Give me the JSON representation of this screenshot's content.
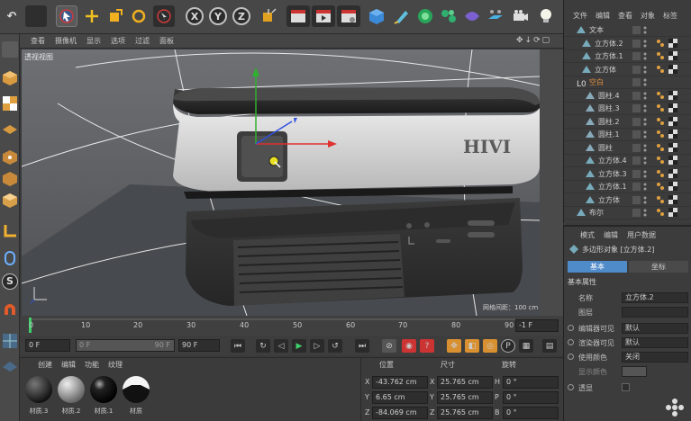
{
  "top_toolbar": {
    "undo": "↶",
    "x": "X",
    "y": "Y",
    "z": "Z"
  },
  "viewport_menu": [
    "查看",
    "摄像机",
    "显示",
    "选项",
    "过滤",
    "面板"
  ],
  "viewport": {
    "label": "透视视图",
    "brand_text": "HIVI",
    "grid_spacing": "网格间距：100 cm"
  },
  "timeline": {
    "ticks": [
      "0",
      "10",
      "20",
      "30",
      "40",
      "50",
      "60",
      "70",
      "80",
      "90"
    ],
    "frame_field": "-1 F"
  },
  "playbar": {
    "start": "0 F",
    "range_start": "0 F",
    "range_end": "90 F",
    "end": "90 F"
  },
  "materials": {
    "menu": [
      "创建",
      "编辑",
      "功能",
      "纹理"
    ],
    "items": [
      "材质.3",
      "材质.2",
      "材质.1",
      "材质"
    ]
  },
  "coordinates": {
    "headers": [
      "位置",
      "尺寸",
      "旋转"
    ],
    "rows": [
      {
        "axis": "X",
        "pos": "-43.762 cm",
        "size": "25.765 cm",
        "rot_axis": "H",
        "rot": "0 °"
      },
      {
        "axis": "Y",
        "pos": "6.65 cm",
        "size": "25.765 cm",
        "rot_axis": "P",
        "rot": "0 °"
      },
      {
        "axis": "Z",
        "pos": "-84.069 cm",
        "size": "25.765 cm",
        "rot_axis": "B",
        "rot": "0 °"
      }
    ]
  },
  "object_manager": {
    "menu": [
      "文件",
      "编辑",
      "查看",
      "对象",
      "标签"
    ],
    "objects": [
      "文本",
      "立方体.2",
      "立方体.1",
      "立方体",
      "空白",
      "圆柱.4",
      "圆柱.3",
      "圆柱.2",
      "圆柱.1",
      "圆柱",
      "立方体.4",
      "立方体.3",
      "立方体.1",
      "立方体",
      "布尔"
    ]
  },
  "attributes": {
    "menu": [
      "模式",
      "编辑",
      "用户数据"
    ],
    "title": "多边形对象 [立方体.2]",
    "tabs": [
      "基本",
      "坐标"
    ],
    "section": "基本属性",
    "fields": [
      {
        "label": "名称",
        "value": "立方体.2"
      },
      {
        "label": "图层",
        "value": ""
      },
      {
        "label": "编辑器可见",
        "value": "默认"
      },
      {
        "label": "渲染器可见",
        "value": "默认"
      },
      {
        "label": "使用颜色",
        "value": "关闭"
      },
      {
        "label": "显示颜色",
        "value": ""
      },
      {
        "label": "透显",
        "value": ""
      }
    ]
  },
  "colors": {
    "accent_blue": "#4f8ac9",
    "axis_red": "#e03030",
    "axis_green": "#2fb030",
    "axis_blue": "#3050e0"
  }
}
